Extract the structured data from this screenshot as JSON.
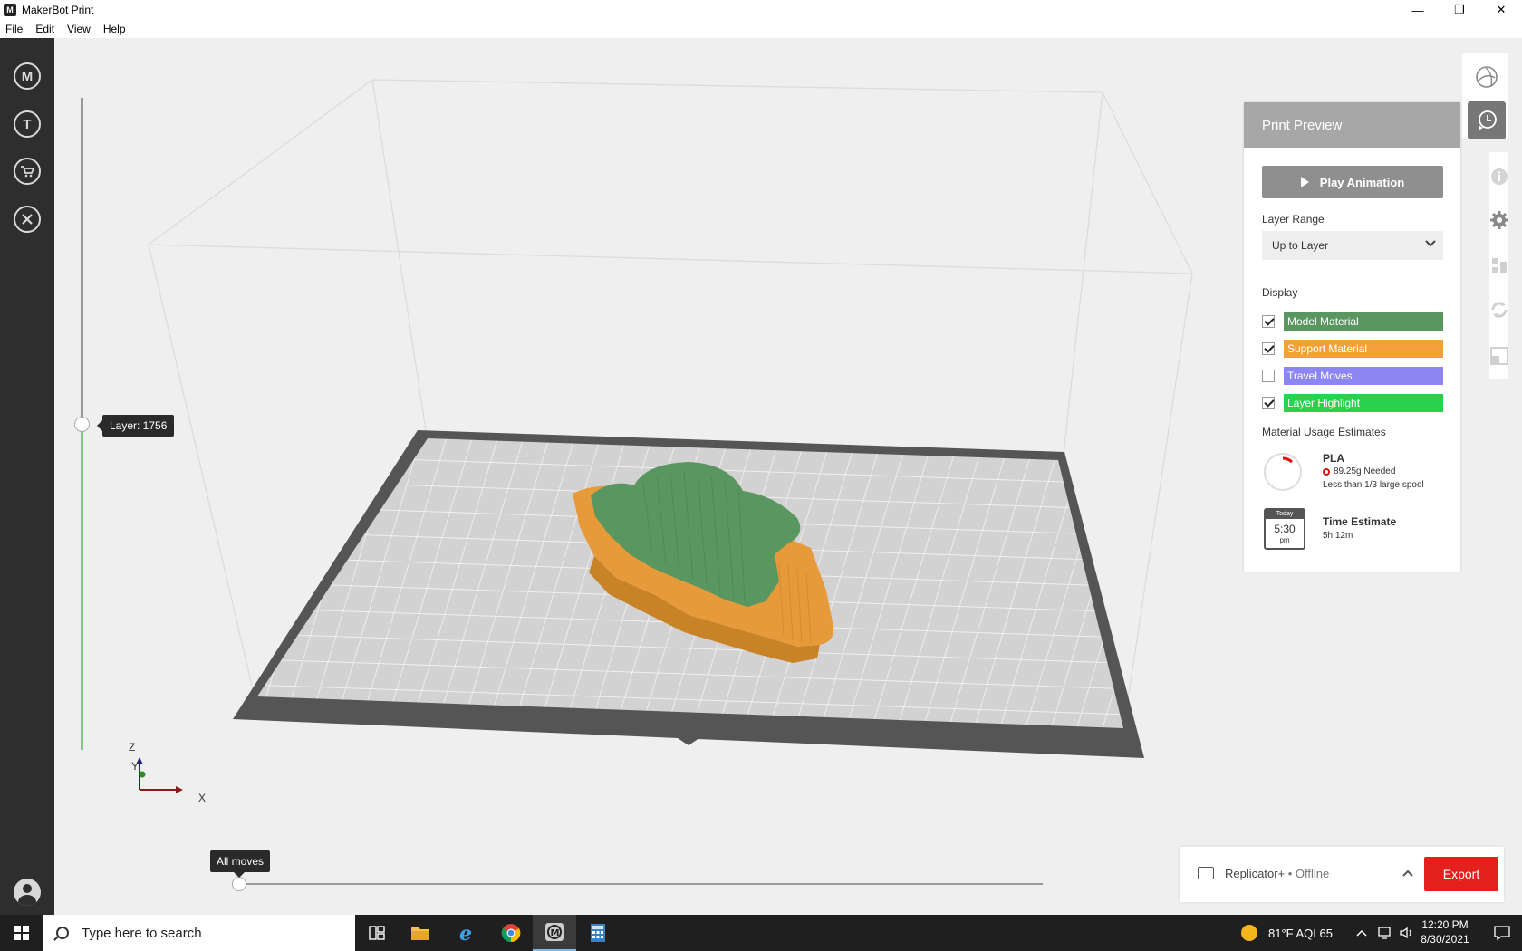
{
  "window": {
    "title": "MakerBot Print",
    "controls": {
      "minimize": "—",
      "maximize": "❐",
      "close": "✕"
    }
  },
  "menu": [
    "File",
    "Edit",
    "View",
    "Help"
  ],
  "left_nav": [
    {
      "name": "makerbot-logo-icon",
      "glyph": "M"
    },
    {
      "name": "thingiverse-icon",
      "glyph": "T"
    },
    {
      "name": "store-cart-icon",
      "glyph": "🛒"
    },
    {
      "name": "tools-icon",
      "glyph": "✕"
    }
  ],
  "viewport": {
    "layer_tooltip": "Layer: 1756",
    "moves_tooltip": "All moves",
    "axis": {
      "z": "Z",
      "y": "Y",
      "x": "X"
    }
  },
  "panel": {
    "title": "Print Preview",
    "play_label": "Play Animation",
    "layer_range_label": "Layer Range",
    "layer_range_value": "Up to Layer",
    "display_label": "Display",
    "display_items": [
      {
        "label": "Model Material",
        "checked": true,
        "color": "#5a9660"
      },
      {
        "label": "Support Material",
        "checked": true,
        "color": "#f3a03a"
      },
      {
        "label": "Travel Moves",
        "checked": false,
        "color": "#8b86f2"
      },
      {
        "label": "Layer Highlight",
        "checked": true,
        "color": "#2ad14a"
      }
    ],
    "material_label": "Material Usage Estimates",
    "material_name": "PLA",
    "material_needed": "89.25g  Needed",
    "material_spool": "Less than 1/3 large spool",
    "time_today": "Today",
    "time_clock": "5:30",
    "time_ampm": "pm",
    "time_title": "Time Estimate",
    "time_value": "5h 12m"
  },
  "printer": {
    "name": "Replicator+",
    "status": " • Offline",
    "export_label": "Export"
  },
  "taskbar": {
    "search_placeholder": "Type here to search",
    "weather": "81°F  AQI 65",
    "time": "12:20 PM",
    "date": "8/30/2021"
  },
  "colors": {
    "model": "#5a9660",
    "support": "#e69a3a",
    "export": "#e3201b"
  }
}
